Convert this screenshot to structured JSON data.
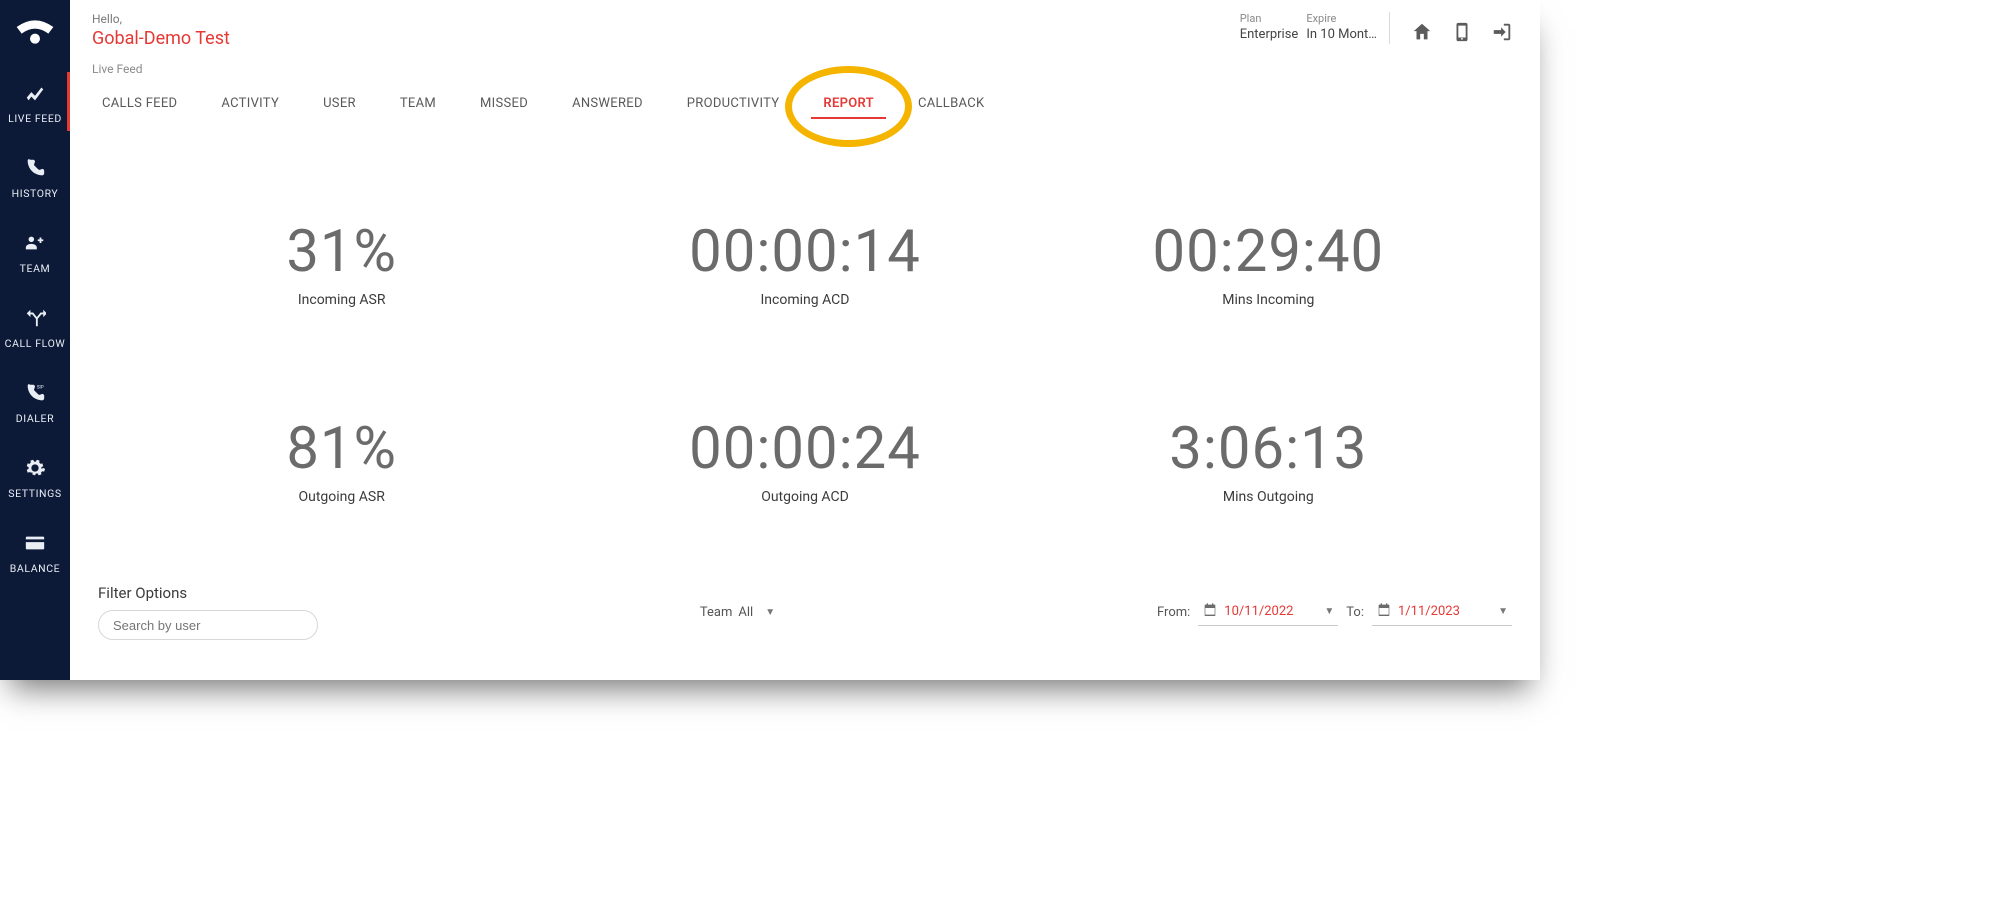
{
  "sidebar": {
    "items": [
      {
        "label": "LIVE FEED",
        "active": true
      },
      {
        "label": "HISTORY"
      },
      {
        "label": "TEAM"
      },
      {
        "label": "CALL FLOW"
      },
      {
        "label": "DIALER"
      },
      {
        "label": "SETTINGS"
      },
      {
        "label": "BALANCE"
      }
    ]
  },
  "header": {
    "greeting": "Hello,",
    "account_name": "Gobal-Demo Test",
    "plan_label": "Plan",
    "plan_value": "Enterprise",
    "expire_label": "Expire",
    "expire_value": "In 10 Mont…"
  },
  "subheader": {
    "breadcrumb": "Live Feed"
  },
  "tabs": [
    {
      "label": "CALLS FEED"
    },
    {
      "label": "ACTIVITY"
    },
    {
      "label": "USER"
    },
    {
      "label": "TEAM"
    },
    {
      "label": "MISSED"
    },
    {
      "label": "ANSWERED"
    },
    {
      "label": "PRODUCTIVITY"
    },
    {
      "label": "REPORT",
      "active": true
    },
    {
      "label": "CALLBACK"
    }
  ],
  "stats": [
    {
      "value": "31%",
      "label": "Incoming ASR"
    },
    {
      "value": "00:00:14",
      "label": "Incoming ACD"
    },
    {
      "value": "00:29:40",
      "label": "Mins Incoming"
    },
    {
      "value": "81%",
      "label": "Outgoing ASR"
    },
    {
      "value": "00:00:24",
      "label": "Outgoing ACD"
    },
    {
      "value": "3:06:13",
      "label": "Mins Outgoing"
    }
  ],
  "filter": {
    "title": "Filter Options",
    "search_placeholder": "Search by user",
    "team_label": "Team",
    "team_value": "All",
    "from_label": "From:",
    "from_value": "10/11/2022",
    "to_label": "To:",
    "to_value": "1/11/2023"
  },
  "annotation": {
    "highlight_tab": "REPORT"
  }
}
